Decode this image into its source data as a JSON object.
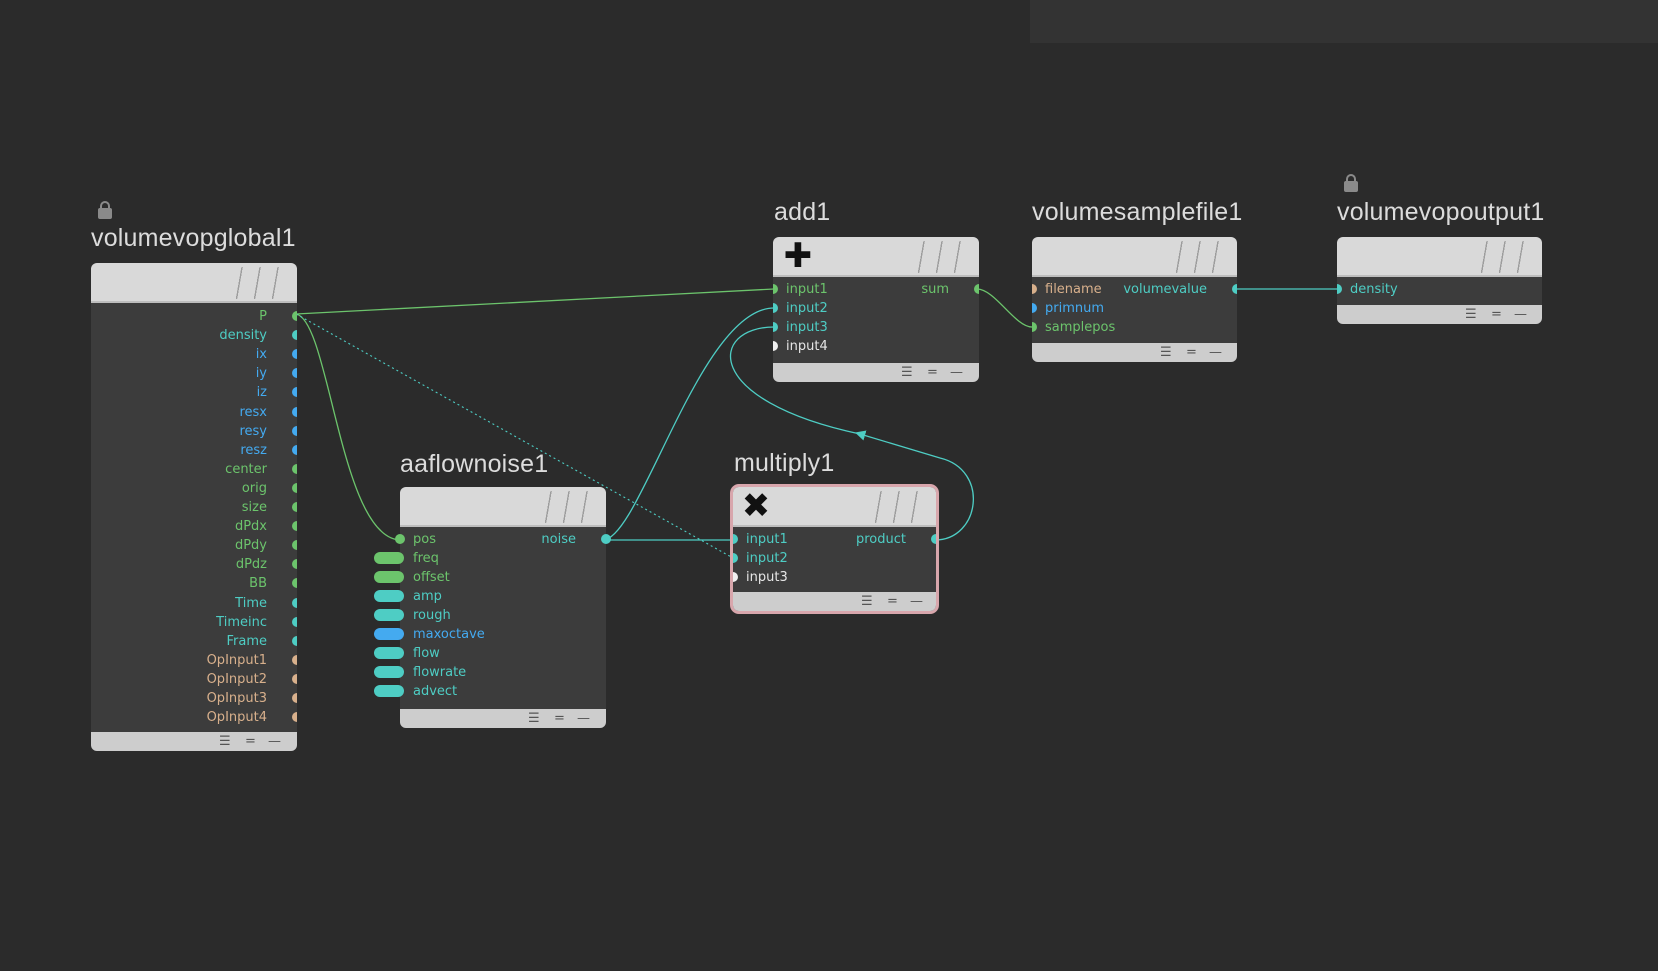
{
  "colors": {
    "background": "#2b2b2b",
    "node_body": "#3c3c3c",
    "node_header": "#d9d9d9",
    "green": "#6cc46c",
    "teal": "#4ecdc4",
    "blue": "#44aaf0",
    "tan": "#d8b08c",
    "white": "#f0f0f0",
    "selected_outline": "#d8a6ac"
  },
  "nodes": {
    "global": {
      "title": "volumevopglobal1",
      "locked": true,
      "outputs": [
        {
          "label": "P",
          "color": "green"
        },
        {
          "label": "density",
          "color": "teal"
        },
        {
          "label": "ix",
          "color": "blue"
        },
        {
          "label": "iy",
          "color": "blue"
        },
        {
          "label": "iz",
          "color": "blue"
        },
        {
          "label": "resx",
          "color": "blue"
        },
        {
          "label": "resy",
          "color": "blue"
        },
        {
          "label": "resz",
          "color": "blue"
        },
        {
          "label": "center",
          "color": "green"
        },
        {
          "label": "orig",
          "color": "green"
        },
        {
          "label": "size",
          "color": "green"
        },
        {
          "label": "dPdx",
          "color": "green"
        },
        {
          "label": "dPdy",
          "color": "green"
        },
        {
          "label": "dPdz",
          "color": "green"
        },
        {
          "label": "BB",
          "color": "green"
        },
        {
          "label": "Time",
          "color": "teal"
        },
        {
          "label": "Timeinc",
          "color": "teal"
        },
        {
          "label": "Frame",
          "color": "teal"
        },
        {
          "label": "OpInput1",
          "color": "tan"
        },
        {
          "label": "OpInput2",
          "color": "tan"
        },
        {
          "label": "OpInput3",
          "color": "tan"
        },
        {
          "label": "OpInput4",
          "color": "tan"
        }
      ]
    },
    "noise": {
      "title": "aaflownoise1",
      "inputs": [
        {
          "label": "pos",
          "color": "green",
          "kind": "dot"
        },
        {
          "label": "freq",
          "color": "green",
          "kind": "pill"
        },
        {
          "label": "offset",
          "color": "green",
          "kind": "pill"
        },
        {
          "label": "amp",
          "color": "teal",
          "kind": "pill"
        },
        {
          "label": "rough",
          "color": "teal",
          "kind": "pill"
        },
        {
          "label": "maxoctave",
          "color": "blue",
          "kind": "pill"
        },
        {
          "label": "flow",
          "color": "teal",
          "kind": "pill"
        },
        {
          "label": "flowrate",
          "color": "teal",
          "kind": "pill"
        },
        {
          "label": "advect",
          "color": "teal",
          "kind": "pill"
        }
      ],
      "outputs": [
        {
          "label": "noise",
          "color": "teal"
        }
      ]
    },
    "add": {
      "title": "add1",
      "icon": "plus-icon",
      "inputs": [
        {
          "label": "input1",
          "color": "green"
        },
        {
          "label": "input2",
          "color": "teal"
        },
        {
          "label": "input3",
          "color": "teal"
        },
        {
          "label": "input4",
          "color": "white"
        }
      ],
      "outputs": [
        {
          "label": "sum",
          "color": "green"
        }
      ]
    },
    "multiply": {
      "title": "multiply1",
      "icon": "cross-icon",
      "selected": true,
      "inputs": [
        {
          "label": "input1",
          "color": "teal"
        },
        {
          "label": "input2",
          "color": "teal"
        },
        {
          "label": "input3",
          "color": "white"
        }
      ],
      "outputs": [
        {
          "label": "product",
          "color": "teal"
        }
      ]
    },
    "sample": {
      "title": "volumesamplefile1",
      "inputs": [
        {
          "label": "filename",
          "color": "tan"
        },
        {
          "label": "primnum",
          "color": "blue"
        },
        {
          "label": "samplepos",
          "color": "green"
        }
      ],
      "outputs": [
        {
          "label": "volumevalue",
          "color": "teal"
        }
      ]
    },
    "output": {
      "title": "volumevopoutput1",
      "locked": true,
      "inputs": [
        {
          "label": "density",
          "color": "teal"
        }
      ]
    }
  },
  "footer_glyphs": [
    "☰",
    "=",
    "—"
  ]
}
